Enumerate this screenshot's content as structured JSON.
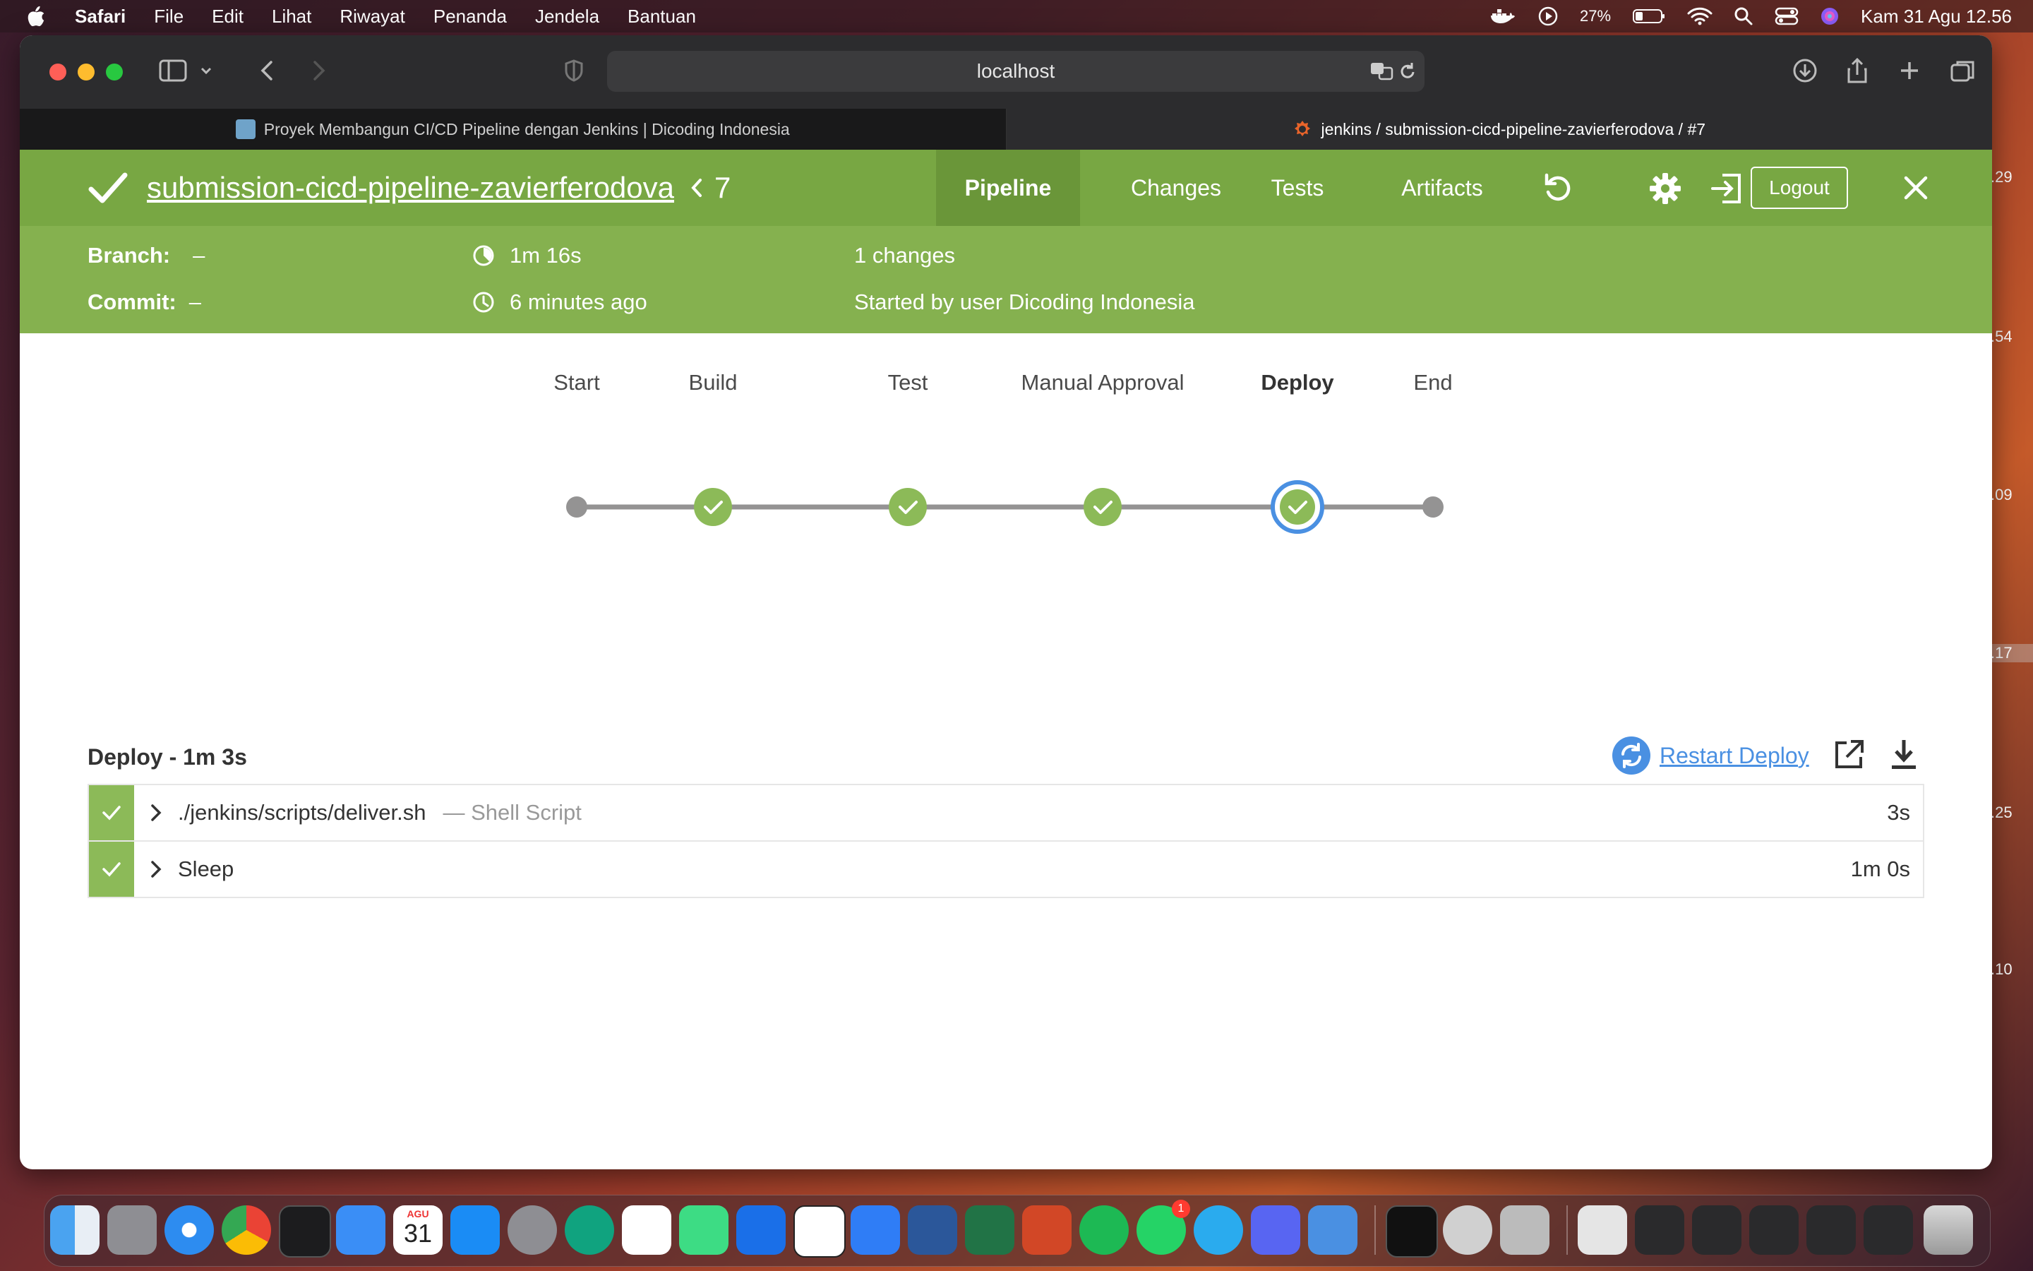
{
  "menubar": {
    "app_name": "Safari",
    "items": [
      "File",
      "Edit",
      "Lihat",
      "Riwayat",
      "Penanda",
      "Jendela",
      "Bantuan"
    ],
    "battery": "27%",
    "clock": "Kam 31 Agu  12.56"
  },
  "side_widgets": [
    ".29",
    ".54",
    ".09",
    ".17",
    ".25",
    ".10"
  ],
  "browser": {
    "address": "localhost",
    "tabs": [
      {
        "title": "Proyek Membangun CI/CD Pipeline dengan Jenkins | Dicoding Indonesia",
        "icon": "dicoding-favicon",
        "active": false
      },
      {
        "title": "jenkins / submission-cicd-pipeline-zavierferodova / #7",
        "icon": "jenkins-favicon",
        "active": true
      }
    ]
  },
  "jenkins": {
    "pipeline_name": "submission-cicd-pipeline-zavierferodova",
    "run_number": "7",
    "nav_tabs": [
      "Pipeline",
      "Changes",
      "Tests",
      "Artifacts"
    ],
    "active_tab": "Pipeline",
    "logout_label": "Logout",
    "meta": {
      "branch_label": "Branch:",
      "branch_value": "–",
      "commit_label": "Commit:",
      "commit_value": "–",
      "duration": "1m 16s",
      "time_ago": "6 minutes ago",
      "changes": "1 changes",
      "started_by": "Started by user Dicoding Indonesia"
    },
    "stages": [
      {
        "name": "Start",
        "status": "node"
      },
      {
        "name": "Build",
        "status": "success"
      },
      {
        "name": "Test",
        "status": "success"
      },
      {
        "name": "Manual Approval",
        "status": "success"
      },
      {
        "name": "Deploy",
        "status": "success",
        "selected": true
      },
      {
        "name": "End",
        "status": "node"
      }
    ],
    "step_section": {
      "title": "Deploy - 1m 3s",
      "restart_label": "Restart Deploy"
    },
    "steps": [
      {
        "name": "./jenkins/scripts/deliver.sh",
        "desc": "— Shell Script",
        "duration": "3s"
      },
      {
        "name": "Sleep",
        "desc": "",
        "duration": "1m 0s"
      }
    ]
  },
  "dock": {
    "calendar_month": "AGU",
    "calendar_day": "31",
    "whatsapp_badge": "1"
  },
  "colors": {
    "jenkins_green_dark": "#78a743",
    "jenkins_green_light": "#85b14f",
    "success_green": "#8cba58",
    "selected_ring": "#4a90e2",
    "link_blue": "#4a90e2"
  }
}
